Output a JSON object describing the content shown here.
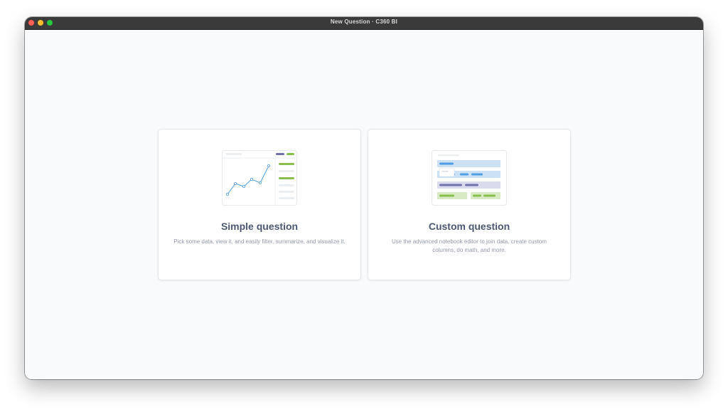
{
  "window": {
    "title": "New Question · C360 BI"
  },
  "options": [
    {
      "title": "Simple question",
      "description": "Pick some data, view it, and easily filter, summarize, and visualize it."
    },
    {
      "title": "Custom question",
      "description": "Use the advanced notebook editor to join data, create custom columns, do math, and more."
    }
  ],
  "colors": {
    "brand_blue": "#509ee3",
    "accent_purple": "#7172ad",
    "accent_green": "#88bf4d",
    "title_text": "#4c5773",
    "muted_text": "#949aab"
  }
}
